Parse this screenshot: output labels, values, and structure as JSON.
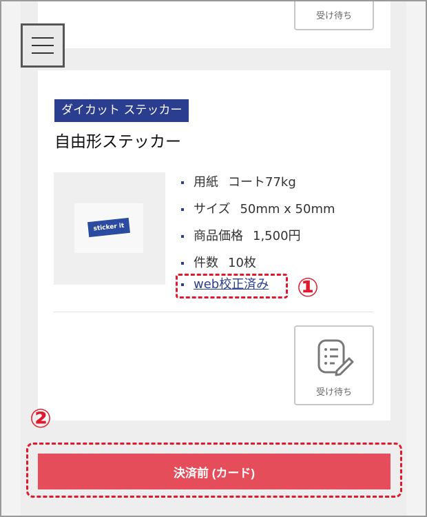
{
  "prev_order": {
    "status_label": "受け待ち"
  },
  "menu": {
    "icon": "hamburger-menu-icon"
  },
  "order": {
    "category": "ダイカット ステッカー",
    "product_name": "自由形ステッカー",
    "thumbnail_text": "sticker it",
    "specs": [
      {
        "label": "用紙",
        "value": "コート77kg"
      },
      {
        "label": "サイズ",
        "value": "50mm x 50mm"
      },
      {
        "label": "商品価格",
        "value": "1,500円"
      },
      {
        "label": "件数",
        "value": "10枚"
      }
    ],
    "proof_link": "web校正済み",
    "status": {
      "icon": "document-edit-icon",
      "label": "受け待ち"
    }
  },
  "annotations": {
    "marker_1": "①",
    "marker_2": "②"
  },
  "payment": {
    "button_label": "決済前 (カード)"
  },
  "colors": {
    "brand_navy": "#2b3d8f",
    "accent_red": "#e0192e",
    "pay_button": "#e64d5b"
  }
}
